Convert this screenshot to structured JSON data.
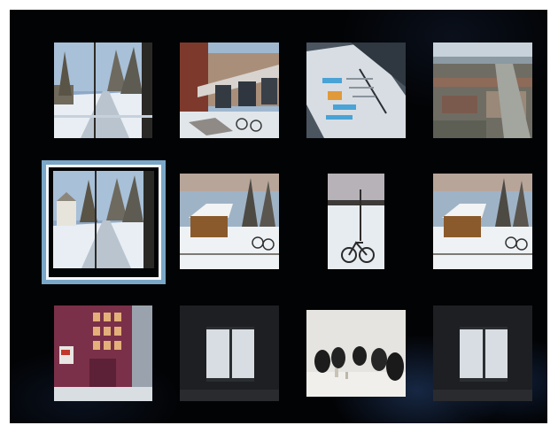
{
  "screen": {
    "name": "photo-thumbnail-browser",
    "selected_index": 4,
    "selection_color": "#7aa7c7",
    "background_color": "#020305"
  },
  "thumbnails": [
    {
      "subject": "snowy-road-with-trees"
    },
    {
      "subject": "red-brick-building-in-snow"
    },
    {
      "subject": "documents-on-table"
    },
    {
      "subject": "aerial-city-view"
    },
    {
      "subject": "snowy-road-with-trees"
    },
    {
      "subject": "wooden-shed-in-snow"
    },
    {
      "subject": "bicycle-in-snow"
    },
    {
      "subject": "wooden-shed-in-snow"
    },
    {
      "subject": "red-building-facade"
    },
    {
      "subject": "dark-room-window"
    },
    {
      "subject": "meeting-room-people"
    },
    {
      "subject": "dark-room-window"
    }
  ]
}
